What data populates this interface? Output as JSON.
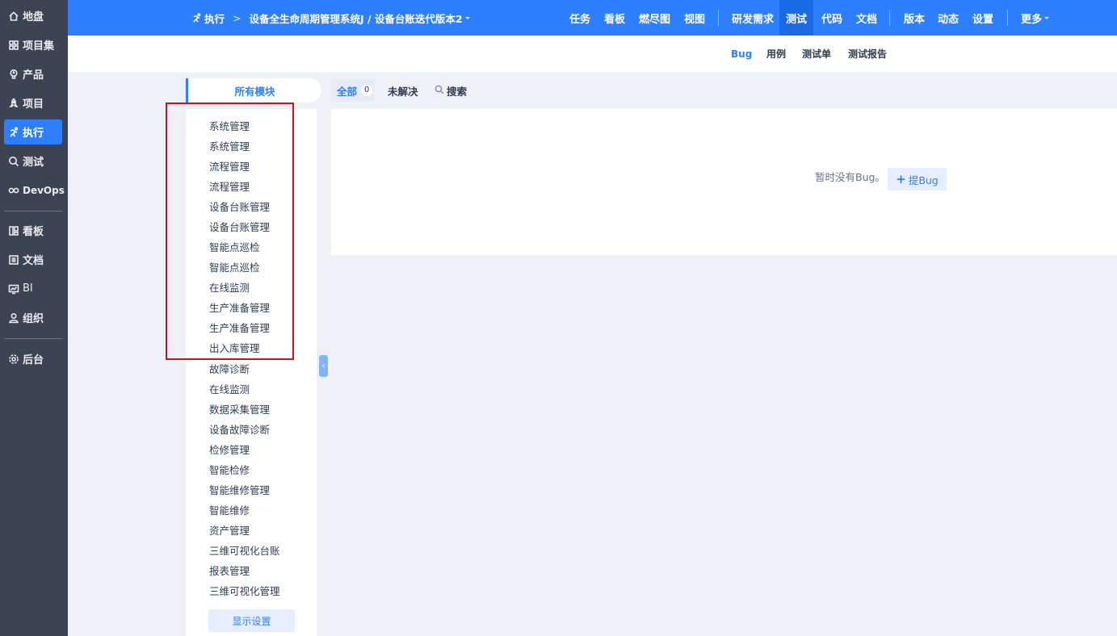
{
  "leftnav": {
    "items": [
      {
        "label": "地盘",
        "icon": "home-icon"
      },
      {
        "label": "项目集",
        "icon": "grid-icon"
      },
      {
        "label": "产品",
        "icon": "bulb-icon"
      },
      {
        "label": "项目",
        "icon": "rocket-icon"
      },
      {
        "label": "执行",
        "icon": "run-icon",
        "active": true
      },
      {
        "label": "测试",
        "icon": "search-icon"
      },
      {
        "label": "DevOps",
        "icon": "infinity-icon"
      },
      {
        "label": "看板",
        "icon": "kanban-icon"
      },
      {
        "label": "文档",
        "icon": "doc-icon"
      },
      {
        "label": "BI",
        "icon": "chart-icon"
      },
      {
        "label": "组织",
        "icon": "user-icon"
      },
      {
        "label": "后台",
        "icon": "gear-icon"
      }
    ]
  },
  "header": {
    "section": "执行",
    "separator": ">",
    "breadcrumb": "设备全生命周期管理系统J / 设备台账迭代版本2",
    "nav": [
      {
        "label": "任务"
      },
      {
        "label": "看板"
      },
      {
        "label": "燃尽图"
      },
      {
        "label": "视图"
      },
      {
        "label": "研发需求"
      },
      {
        "label": "测试",
        "active": true
      },
      {
        "label": "代码"
      },
      {
        "label": "文档"
      },
      {
        "label": "版本"
      },
      {
        "label": "动态"
      },
      {
        "label": "设置"
      },
      {
        "label": "更多"
      }
    ],
    "accent_color": "#2e7fff"
  },
  "subnav": {
    "items": [
      {
        "label": "Bug",
        "active": true
      },
      {
        "label": "用例"
      },
      {
        "label": "测试单"
      },
      {
        "label": "测试报告"
      }
    ]
  },
  "modules": {
    "title": "所有模块",
    "items": [
      "系统管理",
      "系统管理",
      "流程管理",
      "流程管理",
      "设备台账管理",
      "设备台账管理",
      "智能点巡检",
      "智能点巡检",
      "在线监测",
      "生产准备管理",
      "生产准备管理",
      "出入库管理",
      "故障诊断",
      "在线监测",
      "数据采集管理",
      "设备故障诊断",
      "检修管理",
      "智能检修",
      "智能维修管理",
      "智能维修",
      "资产管理",
      "三维可视化台账",
      "报表管理",
      "三维可视化管理"
    ],
    "display_settings": "显示设置",
    "highlight_color": "#d0101a"
  },
  "filters": {
    "all_label": "全部",
    "all_count": "0",
    "unresolved": "未解决",
    "search": "搜索"
  },
  "main": {
    "empty_text": "暂时没有Bug。",
    "add_bug": "提Bug"
  }
}
